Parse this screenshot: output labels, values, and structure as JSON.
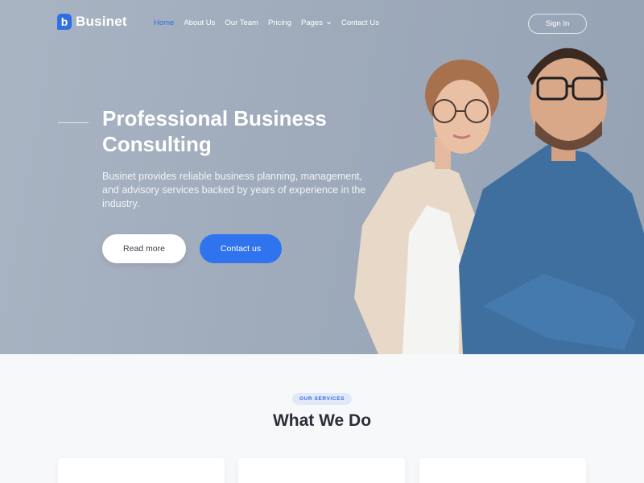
{
  "brand": {
    "name": "Businet",
    "mark": "b",
    "accent": "#2f6fe4"
  },
  "nav": {
    "items": [
      {
        "label": "Home",
        "active": true
      },
      {
        "label": "About Us",
        "active": false
      },
      {
        "label": "Our Team",
        "active": false
      },
      {
        "label": "Pricing",
        "active": false
      },
      {
        "label": "Pages",
        "active": false,
        "has_dropdown": true
      },
      {
        "label": "Contact Us",
        "active": false
      }
    ],
    "signin_label": "Sign In"
  },
  "hero": {
    "title": "Professional Business Consulting",
    "description": "Businet provides reliable business planning, management, and advisory services backed by years of experience in the industry.",
    "read_more_label": "Read more",
    "contact_label": "Contact us"
  },
  "services": {
    "badge": "OUR SERVICES",
    "title": "What We Do"
  }
}
